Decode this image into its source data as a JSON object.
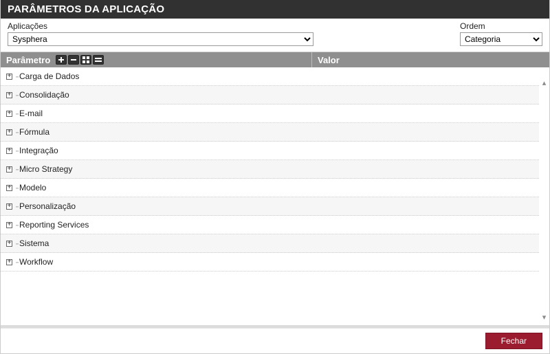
{
  "title": "PARÂMETROS DA APLICAÇÃO",
  "filters": {
    "applications_label": "Aplicações",
    "applications_selected": "Sysphera",
    "order_label": "Ordem",
    "order_selected": "Categoria"
  },
  "grid": {
    "columns": {
      "parameter": "Parâmetro",
      "value": "Valor"
    },
    "rows": [
      {
        "label": "Carga de Dados"
      },
      {
        "label": "Consolidação"
      },
      {
        "label": "E-mail"
      },
      {
        "label": "Fórmula"
      },
      {
        "label": "Integração"
      },
      {
        "label": "Micro Strategy"
      },
      {
        "label": "Modelo"
      },
      {
        "label": "Personalização"
      },
      {
        "label": "Reporting Services"
      },
      {
        "label": "Sistema"
      },
      {
        "label": "Workflow"
      }
    ]
  },
  "footer": {
    "close": "Fechar"
  }
}
